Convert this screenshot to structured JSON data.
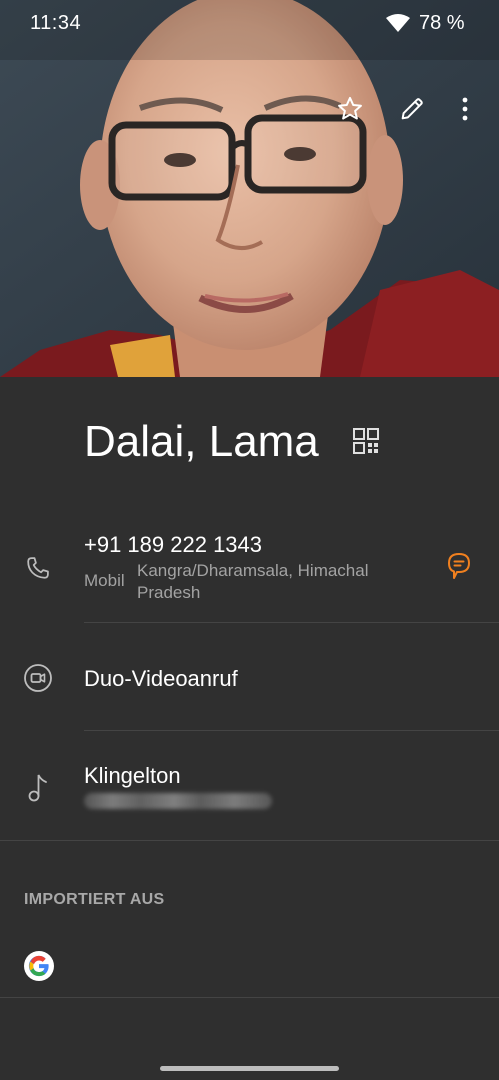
{
  "status_bar": {
    "time": "11:34",
    "battery": "78 %",
    "wifi_icon": "wifi-icon"
  },
  "header_actions": {
    "favorite_icon": "star-outline-icon",
    "edit_icon": "pencil-icon",
    "more_icon": "more-vertical-icon"
  },
  "contact": {
    "name": "Dalai, Lama",
    "qr_icon": "qr-code-icon"
  },
  "phone": {
    "number": "+91 189 222 1343",
    "type_label": "Mobil",
    "location": "Kangra/Dharamsala, Himachal Pradesh",
    "icon": "phone-icon",
    "message_icon": "message-bubble-icon",
    "accent_color": "#f0801f"
  },
  "video_call": {
    "label": "Duo-Videoanruf",
    "icon": "video-camera-icon"
  },
  "ringtone": {
    "label": "Klingelton",
    "icon": "music-note-icon"
  },
  "imported_from": {
    "heading": "IMPORTIERT AUS",
    "source_icon": "google-logo-icon"
  },
  "colors": {
    "background": "#2f2f2f",
    "text_primary": "#ffffff",
    "text_secondary": "#a3a3a3",
    "divider": "#444444"
  }
}
